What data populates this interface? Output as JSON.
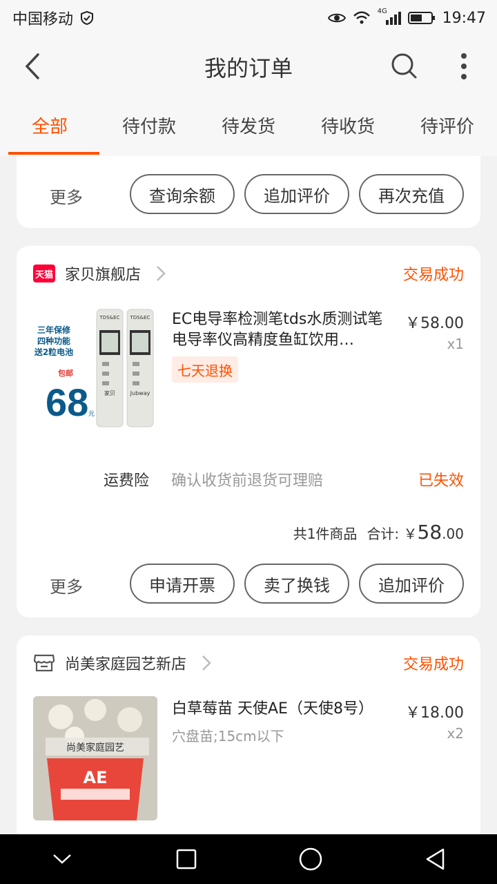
{
  "statusbar": {
    "carrier": "中国移动",
    "network": "4G",
    "time": "19:47"
  },
  "header": {
    "title": "我的订单"
  },
  "tabs": [
    "全部",
    "待付款",
    "待发货",
    "待收货",
    "待评价"
  ],
  "card0": {
    "more": "更多",
    "buttons": [
      "查询余额",
      "追加评价",
      "再次充值"
    ]
  },
  "order1": {
    "shop_badge": "天猫",
    "shop_name": "家贝旗舰店",
    "status": "交易成功",
    "product_title": "EC电导率检测笔tds水质测试笔电导率仪高精度鱼缸饮用…",
    "price": "￥58.00",
    "qty": "x1",
    "tag": "七天退换",
    "thumb_text": {
      "warranty": "三年保修",
      "functions": "四种功能",
      "battery": "送2粒电池",
      "free_ship": "包邮",
      "price": "68",
      "unit": "元",
      "brand1": "家贝",
      "brand2": "Jubway",
      "model": "TDS&EC"
    },
    "insurance_label": "运费险",
    "insurance_desc": "确认收货前退货可理赔",
    "insurance_status": "已失效",
    "count_text": "共1件商品",
    "total_label": "合计:",
    "total_currency": "￥",
    "total_int": "58",
    "total_dec": ".00",
    "more": "更多",
    "buttons": [
      "申请开票",
      "卖了换钱",
      "追加评价"
    ]
  },
  "order2": {
    "shop_name": "尚美家庭园艺新店",
    "status": "交易成功",
    "product_title": "白草莓苗  天使AE（天使8号）",
    "sku": "穴盘苗;15cm以下",
    "price": "￥18.00",
    "qty": "x2",
    "thumb_text": {
      "shop": "尚美家庭园艺",
      "label": "AE"
    }
  },
  "colors": {
    "accent": "#ff5000",
    "tmall": "#ff0036"
  }
}
